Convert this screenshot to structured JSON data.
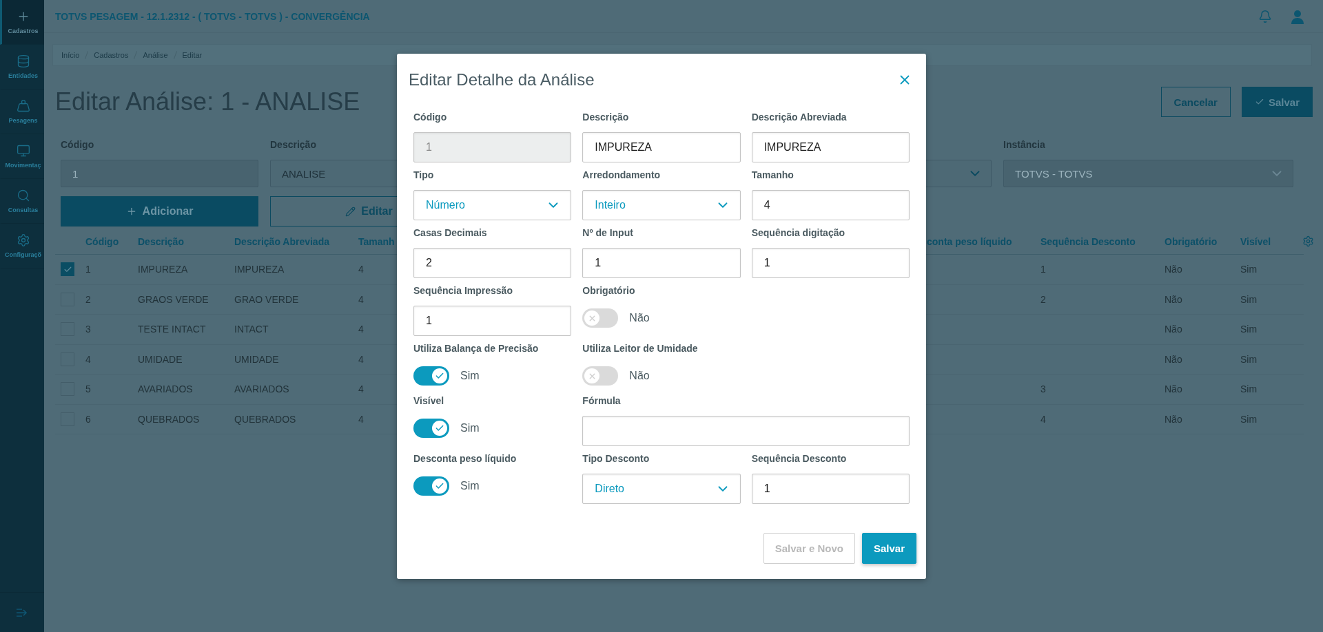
{
  "sidebar": {
    "items": [
      {
        "label": "Cadastros",
        "kind": "plus",
        "selected": true
      },
      {
        "label": "Entidades",
        "kind": "database",
        "selected": false
      },
      {
        "label": "Pesagens",
        "kind": "weight",
        "selected": false
      },
      {
        "label": "Movimentaç",
        "kind": "monitor",
        "selected": false
      },
      {
        "label": "Consultas",
        "kind": "search",
        "selected": false
      },
      {
        "label": "Configuraçõ",
        "kind": "settings",
        "selected": false
      }
    ]
  },
  "header": {
    "title": "TOTVS PESAGEM - 12.1.2312 - ( TOTVS - TOTVS ) - CONVERGÊNCIA"
  },
  "breadcrumb": [
    "Início",
    "Cadastros",
    "Análise",
    "Editar"
  ],
  "page": {
    "title": "Editar Análise: 1 - ANALISE",
    "actions": [
      {
        "label": "Cancelar",
        "kind": "outline"
      },
      {
        "label": "Salvar",
        "kind": "primary"
      }
    ]
  },
  "filters": [
    {
      "label": "Código",
      "value": "1",
      "kind": "input",
      "disabled": true
    },
    {
      "label": "Descrição",
      "value": "ANALISE",
      "kind": "input",
      "disabled": false
    },
    {
      "kind": "select",
      "disabled": false
    },
    {
      "label": "Instância",
      "value": "TOTVS - TOTVS",
      "kind": "select",
      "disabled": true
    }
  ],
  "toolbar": [
    {
      "label": "Adicionar",
      "kind": "primary"
    },
    {
      "label": "Editar",
      "kind": "outline"
    }
  ],
  "table": {
    "columns_left": [
      "Código",
      "Descrição",
      "Descrição Abreviada",
      "Tamanh"
    ],
    "columns_right": [
      "conta peso líquido",
      "Sequência Desconto",
      "Obrigatório",
      "Visível"
    ],
    "rows": [
      {
        "selected": true,
        "codigo": "1",
        "descricao": "IMPUREZA",
        "descricao_abreviada": "IMPUREZA",
        "tamanho": "4",
        "sequencia_desconto": "1",
        "obrigatorio": "Não",
        "visivel": "Sim"
      },
      {
        "selected": false,
        "codigo": "2",
        "descricao": "GRAOS VERDE",
        "descricao_abreviada": "GRAO VERDE",
        "tamanho": "4",
        "sequencia_desconto": "2",
        "obrigatorio": "Não",
        "visivel": "Sim"
      },
      {
        "selected": false,
        "codigo": "3",
        "descricao": "TESTE INTACT",
        "descricao_abreviada": "INTACT",
        "tamanho": "4",
        "obrigatorio": "Não",
        "visivel": "Sim"
      },
      {
        "selected": false,
        "codigo": "4",
        "descricao": "UMIDADE",
        "descricao_abreviada": "UMIDADE",
        "tamanho": "4",
        "obrigatorio": "Não",
        "visivel": "Sim"
      },
      {
        "selected": false,
        "codigo": "5",
        "descricao": "AVARIADOS",
        "descricao_abreviada": "AVARIADOS",
        "tamanho": "4",
        "sequencia_desconto": "3",
        "obrigatorio": "Não",
        "visivel": "Sim"
      },
      {
        "selected": false,
        "codigo": "6",
        "descricao": "QUEBRADOS",
        "descricao_abreviada": "QUEBRADOS",
        "tamanho": "4",
        "sequencia_desconto": "4",
        "obrigatorio": "Não",
        "visivel": "Sim"
      }
    ]
  },
  "modal": {
    "title": "Editar Detalhe da Análise",
    "fields": [
      {
        "label": "Código",
        "kind": "input",
        "value": "1",
        "disabled": true
      },
      {
        "label": "Descrição",
        "kind": "input",
        "value": "IMPUREZA",
        "disabled": false
      },
      {
        "label": "Descrição Abreviada",
        "kind": "input",
        "value": "IMPUREZA",
        "disabled": false
      },
      {
        "label": "Tipo",
        "kind": "select",
        "value": "Número",
        "disabled": false
      },
      {
        "label": "Arredondamento",
        "kind": "select",
        "value": "Inteiro",
        "disabled": false
      },
      {
        "label": "Tamanho",
        "kind": "input",
        "value": "4",
        "disabled": false
      },
      {
        "label": "Casas Decimais",
        "kind": "input",
        "value": "2",
        "disabled": false
      },
      {
        "label": "Nº de Input",
        "kind": "input",
        "value": "1",
        "disabled": false
      },
      {
        "label": "Sequência digitação",
        "kind": "input",
        "value": "1",
        "disabled": false
      },
      {
        "label": "Sequência Impressão",
        "kind": "input",
        "value": "1",
        "disabled": false
      },
      {
        "label": "Obrigatório",
        "kind": "toggle",
        "value": "Não",
        "on": false,
        "disabled": false
      },
      {
        "kind": "blank"
      },
      {
        "label": "Utiliza Balança de Precisão",
        "kind": "toggle",
        "value": "Sim",
        "on": true,
        "disabled": false
      },
      {
        "label": "Utiliza Leitor de Umidade",
        "kind": "toggle",
        "value": "Não",
        "on": false,
        "disabled": false
      },
      {
        "kind": "blank"
      },
      {
        "label": "Visível",
        "kind": "toggle",
        "value": "Sim",
        "on": true,
        "disabled": false
      },
      {
        "label": "Fórmula",
        "kind": "wide_input",
        "disabled": false
      },
      {
        "label": "Desconta peso líquido",
        "kind": "toggle",
        "value": "Sim",
        "on": true,
        "disabled": false
      },
      {
        "label": "Tipo Desconto",
        "kind": "select",
        "value": "Direto",
        "disabled": false
      },
      {
        "label": "Sequência Desconto",
        "kind": "input",
        "value": "1",
        "disabled": false
      }
    ],
    "buttons": [
      {
        "label": "Salvar e Novo",
        "kind": "secondary",
        "disabled": true
      },
      {
        "label": "Salvar",
        "kind": "primary",
        "disabled": false
      }
    ]
  }
}
